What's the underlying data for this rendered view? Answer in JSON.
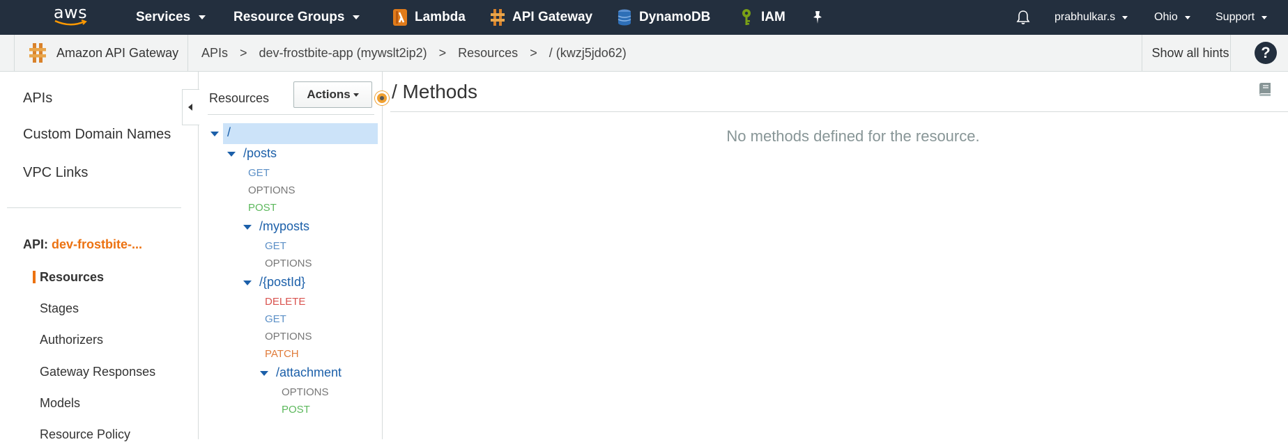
{
  "topnav": {
    "logo_text": "aws",
    "items": [
      {
        "label": "Services",
        "caret": true
      },
      {
        "label": "Resource Groups",
        "caret": true
      }
    ],
    "pinned": [
      {
        "label": "Lambda",
        "icon": "lambda-icon"
      },
      {
        "label": "API Gateway",
        "icon": "api-gateway-icon"
      },
      {
        "label": "DynamoDB",
        "icon": "dynamodb-icon"
      },
      {
        "label": "IAM",
        "icon": "iam-icon"
      }
    ],
    "pin_icon": "pushpin-icon",
    "bell_icon": "bell-icon",
    "user": "prabhulkar.s",
    "region": "Ohio",
    "support": "Support"
  },
  "breadcrumb": {
    "service": "Amazon API Gateway",
    "items": [
      "APIs",
      "dev-frostbite-app (mywslt2ip2)",
      "Resources",
      "/ (kwzj5jdo62)"
    ],
    "separator": ">",
    "hints": "Show all hints",
    "help": "?"
  },
  "sidebar": {
    "links": [
      "APIs",
      "Custom Domain Names",
      "VPC Links"
    ],
    "api_prefix": "API:",
    "api_name": "dev-frostbite-...",
    "sub_items": [
      "Resources",
      "Stages",
      "Authorizers",
      "Gateway Responses",
      "Models",
      "Resource Policy"
    ],
    "active": "Resources"
  },
  "resources_panel": {
    "title": "Resources",
    "actions_label": "Actions",
    "tree": {
      "root": "/",
      "posts": "/posts",
      "posts_methods": [
        "GET",
        "OPTIONS",
        "POST"
      ],
      "myposts": "/myposts",
      "myposts_methods": [
        "GET",
        "OPTIONS"
      ],
      "postId": "/{postId}",
      "postId_methods": [
        "DELETE",
        "GET",
        "OPTIONS",
        "PATCH"
      ],
      "attachment": "/attachment",
      "attachment_methods": [
        "OPTIONS",
        "POST"
      ]
    }
  },
  "main": {
    "title": "/ Methods",
    "empty_message": "No methods defined for the resource."
  },
  "colors": {
    "nav_bg": "#232f3e",
    "accent_orange": "#ec7211",
    "link_blue": "#1b5fa9",
    "selected_bg": "#cce3f9"
  }
}
